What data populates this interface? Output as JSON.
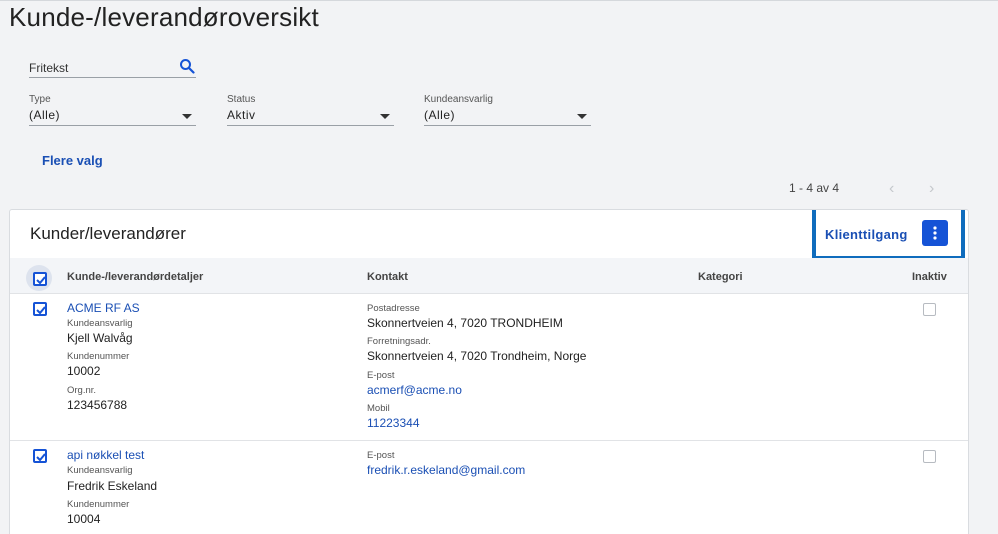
{
  "page": {
    "title": "Kunde-/leverandøroversikt"
  },
  "filters": {
    "search": {
      "placeholder": "Fritekst",
      "value": ""
    },
    "type": {
      "label": "Type",
      "value": "(Alle)"
    },
    "status": {
      "label": "Status",
      "value": "Aktiv"
    },
    "kundeansvarlig": {
      "label": "Kundeansvarlig",
      "value": "(Alle)"
    },
    "more_label": "Flere valg"
  },
  "pager": {
    "info": "1 - 4 av 4",
    "prev": "‹",
    "next": "›"
  },
  "table": {
    "title": "Kunder/leverandører",
    "klienttilgang_label": "Klienttilgang",
    "columns": {
      "details": "Kunde-/leverandørdetaljer",
      "contact": "Kontakt",
      "category": "Kategori",
      "inactive": "Inaktiv"
    },
    "rows": [
      {
        "name": "ACME RF AS",
        "responsible_label": "Kundeansvarlig",
        "responsible": "Kjell Walvåg",
        "number_label": "Kundenummer",
        "number": "10002",
        "org_label": "Org.nr.",
        "org": "123456788",
        "postal_label": "Postadresse",
        "postal": "Skonnertveien 4, 7020 TRONDHEIM",
        "business_label": "Forretningsadr.",
        "business": "Skonnertveien 4, 7020 Trondheim, Norge",
        "email_label": "E-post",
        "email": "acmerf@acme.no",
        "mobile_label": "Mobil",
        "mobile": "11223344",
        "selected": true,
        "inactive": false
      },
      {
        "name": "api nøkkel test",
        "responsible_label": "Kundeansvarlig",
        "responsible": "Fredrik Eskeland",
        "number_label": "Kundenummer",
        "number": "10004",
        "email_label": "E-post",
        "email": "fredrik.r.eskeland@gmail.com",
        "selected": true,
        "inactive": false
      }
    ]
  },
  "colors": {
    "accent": "#1553d6",
    "link": "#1a4fb4",
    "highlight": "#0f6cbd"
  }
}
